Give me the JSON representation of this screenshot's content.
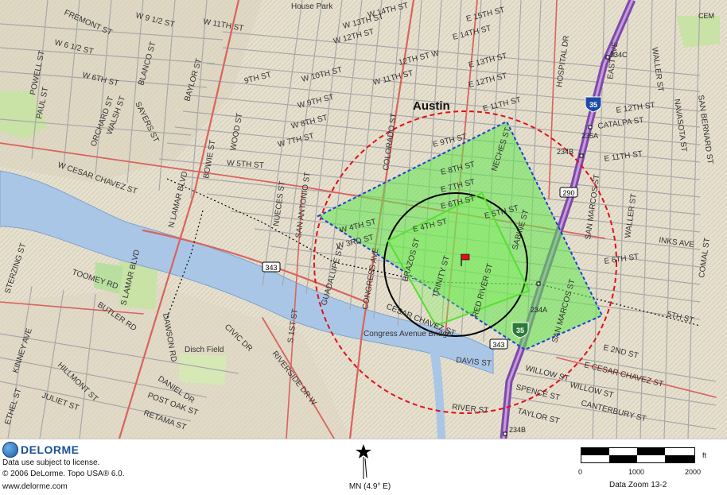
{
  "map": {
    "corner_label": "CEM",
    "city_label": "Austin",
    "place_labels": {
      "house_park": "House Park",
      "congress_bridge": "Congress Avenue Bridge",
      "disch_field": "Disch Field"
    },
    "street_labels": {
      "remont": "FREMONT ST",
      "w9half": "W 9 1/2 ST",
      "w11a": "W 11TH ST",
      "w6half": "W 6 1/2 ST",
      "w6th": "W 6TH ST",
      "blanco": "BLANCO ST",
      "baylor": "BAYLOR ST",
      "powell": "POWELL ST",
      "paul": "PAUL ST",
      "orchard": "ORCHARD ST",
      "walsh": "WALSH ST",
      "sayers": "SAYERS ST",
      "wcesar": "W CESAR CHAVEZ ST",
      "nlamar": "N LAMAR BLVD",
      "bowie": "BOWIE ST",
      "wood": "WOOD ST",
      "w5th": "W 5TH ST",
      "w14th": "W 14TH ST",
      "w13th": "W 13TH ST",
      "w12th": "W 12TH ST",
      "w10th": "W 10TH ST",
      "w9th": "9TH ST",
      "w11b": "W 11TH ST",
      "w9c": "W 9TH ST",
      "w8th": "W 8TH ST",
      "w7th": "W 7TH ST",
      "e15th": "E 15TH ST",
      "e14th": "E 14TH ST",
      "e13th": "E 13TH ST",
      "e12th": "E 12TH ST",
      "e11th": "E 11TH ST",
      "e9th": "E 9TH ST",
      "e8th": "E 8TH ST",
      "e7th": "E 7TH ST",
      "e6th": "E 6TH ST",
      "e5th": "E 5TH ST",
      "e4th": "E 4TH ST",
      "w4th": "W 4TH ST",
      "w3rd": "W 3RD ST",
      "w12thb": "12TH ST W",
      "hospital": "HOSPITAL DR",
      "eastave": "EAST AVE",
      "waller": "WALLER ST",
      "e12thr": "E 12TH ST",
      "catalpa": "CATALPA ST",
      "navasota": "NAVASOTA ST",
      "sanbernard": "SAN BERNARD ST",
      "e11thr": "E 11TH ST",
      "sanmarcos": "SAN MARCOS ST",
      "wallerb": "WALLER ST",
      "inks": "INKS AVE",
      "comal": "COMAL ST",
      "e6thr": "E 6TH ST",
      "e5thr": "5TH ST",
      "e2nd": "E 2ND ST",
      "ecesar": "E CESAR CHAVEZ ST",
      "willow": "WILLOW ST",
      "willowb": "WILLOW ST",
      "spence": "SPENCE ST",
      "canterbury": "CANTERBURY ST",
      "taylor": "TAYLOR ST",
      "sanmarcosb": "SAN MARCOS ST",
      "davis": "DAVIS ST",
      "river": "RIVER ST",
      "colorado": "COLORADO ST",
      "neches": "NECHES ST",
      "sabine": "SABINE ST",
      "redriver": "RED RIVER ST",
      "trinity": "TRINITY ST",
      "brazos": "BRAZOS ST",
      "congress": "CONGRESS AVE",
      "sanantonio": "SAN ANTONIO ST",
      "nueces": "NUECES ST",
      "guadalupe": "GUADALUPE ST",
      "slamar": "S LAMAR BLVD",
      "toomey": "TOOMEY RD",
      "butler": "BUTLER RD",
      "dawson": "DAWSON RD",
      "civic": "CIVIC DR",
      "riverside": "RIVERSIDE DR W",
      "s1st": "S 1ST ST",
      "sterzing": "STERZING ST",
      "kinney": "KINNEY AVE",
      "hillmont": "HILLMONT ST",
      "juliet": "JULIET ST",
      "ethel": "ETHEL ST",
      "daniel": "DANIEL DR",
      "postoak": "POST OAK ST",
      "retama": "RETAMA ST",
      "scongress": "S CONGRESS AVE",
      "echavez2": "CESAR CHAVEZ ST"
    },
    "shields": {
      "i35_north": "35",
      "i35_south": "35",
      "r343": "343",
      "r343b": "343",
      "r290": "290"
    },
    "exits": {
      "x234c": "234C",
      "x235a": "235A",
      "x234b1": "234B",
      "x234a": "234A",
      "x234b2": "234B"
    },
    "overlay_colors": {
      "red_circle": "#e0101a",
      "blue_polygon": "#1a3fd6",
      "green_fill": "#5fe84d",
      "black_circle": "#000000",
      "inner_square": "#55e030"
    }
  },
  "footer": {
    "logo_text": "DELORME",
    "license": "Data use subject to license.",
    "copyright": "© 2006 DeLorme. Topo USA® 6.0.",
    "website": "www.delorme.com",
    "north_label": "MN (4.9° E)",
    "scale": {
      "unit": "ft",
      "ticks": [
        "0",
        "1000",
        "2000"
      ],
      "zoom": "Data Zoom 13-2"
    }
  }
}
